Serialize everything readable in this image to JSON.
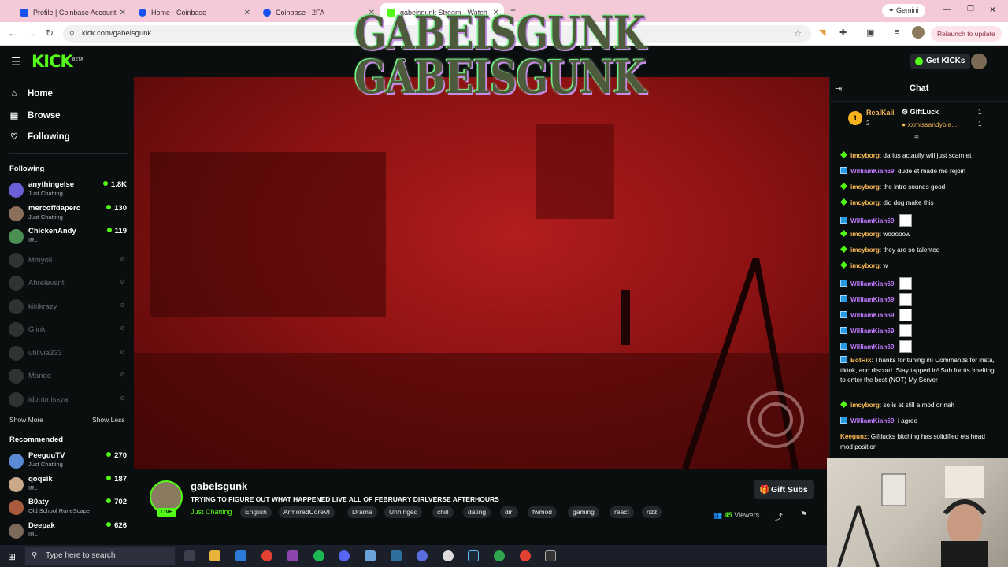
{
  "browser": {
    "tabs": [
      {
        "title": "Profile | Coinbase Account",
        "color": "#1652f0"
      },
      {
        "title": "Home - Coinbase",
        "color": "#1652f0"
      },
      {
        "title": "Coinbase - 2FA",
        "color": "#1652f0"
      },
      {
        "title": "gabeisgunk Stream - Watch",
        "color": "#53fc18"
      }
    ],
    "url": "kick.com/gabeisgunk",
    "relaunch": "Relaunch to update",
    "gemini": "Gemini"
  },
  "kick": {
    "logo": "KICK",
    "logo_sup": "BETA",
    "get_kicks": "Get KICKs",
    "nav": [
      {
        "label": "Home",
        "icon": "home-icon",
        "glyph": "⌂"
      },
      {
        "label": "Browse",
        "icon": "browse-icon",
        "glyph": "▤"
      },
      {
        "label": "Following",
        "icon": "heart-icon",
        "glyph": "♡"
      }
    ],
    "following_title": "Following",
    "following": [
      {
        "name": "anythingelse",
        "category": "Just Chatting",
        "viewers": "1.8K",
        "color": "#6b5fd6"
      },
      {
        "name": "mercoffdaperc",
        "category": "Just Chatting",
        "viewers": "130",
        "color": "#8a6f5a"
      },
      {
        "name": "ChickenAndy",
        "category": "IRL",
        "viewers": "119",
        "color": "#4c8f52"
      },
      {
        "name": "Mmyoil",
        "offline": true,
        "color": "#777"
      },
      {
        "name": "Ahrelevant",
        "offline": true,
        "color": "#777"
      },
      {
        "name": "kikikrazy",
        "offline": true,
        "color": "#777"
      },
      {
        "name": "Glink",
        "offline": true,
        "color": "#777"
      },
      {
        "name": "uhlivia333",
        "offline": true,
        "color": "#777"
      },
      {
        "name": "Mando",
        "offline": true,
        "color": "#777"
      },
      {
        "name": "idontmissya",
        "offline": true,
        "color": "#777"
      }
    ],
    "show_more": "Show More",
    "show_less": "Show Less",
    "recommended_title": "Recommended",
    "recommended": [
      {
        "name": "PeeguuTV",
        "category": "Just Chatting",
        "viewers": "270",
        "color": "#5b8bd6"
      },
      {
        "name": "qoqsik",
        "category": "IRL",
        "viewers": "187",
        "color": "#c9a98a"
      },
      {
        "name": "B0aty",
        "category": "Old School RuneScape",
        "viewers": "702",
        "color": "#a85b3c"
      },
      {
        "name": "Deepak",
        "category": "IRL",
        "viewers": "626",
        "color": "#7a6a5a"
      }
    ]
  },
  "stream": {
    "banner_line1": "GABEISGUNK",
    "banner_line2": "GABEISGUNK",
    "channel": "gabeisgunk",
    "live": "LIVE",
    "title": "TRYING TO FIGURE OUT WHAT HAPPENED  LIVE ALL OF FEBRUARY DIRLVERSE AFTERHOURS",
    "category": "Just Chatting",
    "tags": [
      "English",
      "ArmoredCoreVI",
      "Drama",
      "Unhinged",
      "chill",
      "dating",
      "dirl",
      "fwmod",
      "gaming",
      "react",
      "rizz"
    ],
    "viewers": "45",
    "viewers_label": "Viewers",
    "gift_subs": "Gift Subs"
  },
  "chat": {
    "title": "Chat",
    "leaderboard": [
      {
        "rank": "1",
        "name": "RealKali",
        "count": "2"
      },
      {
        "name": "GiftLuck",
        "count": "1"
      },
      {
        "name": "xxmissandybla...",
        "count": "1"
      }
    ],
    "messages": [
      {
        "user": "imcyborg",
        "badge": "green",
        "color": "#f7b955",
        "text": "darius actaully will just scam et"
      },
      {
        "user": "WilliamKian69",
        "badge": "sub",
        "color": "#c27cff",
        "text": "dude et made me rejoin"
      },
      {
        "user": "imcyborg",
        "badge": "green",
        "color": "#f7b955",
        "text": "the intro sounds good"
      },
      {
        "user": "imcyborg",
        "badge": "green",
        "color": "#f7b955",
        "text": "did dog make this"
      },
      {
        "user": "WilliamKian69",
        "badge": "sub",
        "color": "#c27cff",
        "text": "",
        "emote": true
      },
      {
        "user": "imcyborg",
        "badge": "green",
        "color": "#f7b955",
        "text": "wooooow"
      },
      {
        "user": "imcyborg",
        "badge": "green",
        "color": "#f7b955",
        "text": "they are so talented"
      },
      {
        "user": "imcyborg",
        "badge": "green",
        "color": "#f7b955",
        "text": "w"
      },
      {
        "user": "WilliamKian69",
        "badge": "sub",
        "color": "#c27cff",
        "text": "",
        "emote": true
      },
      {
        "user": "WilliamKian69",
        "badge": "sub",
        "color": "#c27cff",
        "text": "",
        "emote": true
      },
      {
        "user": "WilliamKian69",
        "badge": "sub",
        "color": "#c27cff",
        "text": "",
        "emote": true
      },
      {
        "user": "WilliamKian69",
        "badge": "sub",
        "color": "#c27cff",
        "text": "",
        "emote": true
      },
      {
        "user": "WilliamKian69",
        "badge": "sub",
        "color": "#c27cff",
        "text": "",
        "emote": true
      },
      {
        "user": "BotRix",
        "badge": "sub",
        "color": "#f7b955",
        "text": "Thanks for tuning in! Commands for insta, tiktok, and discord. Stay tapped in! Sub for tts !melting to enter the best (NOT) My Server"
      },
      {
        "user": "imcyborg",
        "badge": "green",
        "color": "#f7b955",
        "text": "so is et still a mod or nah"
      },
      {
        "user": "WilliamKian69",
        "badge": "sub",
        "color": "#c27cff",
        "text": "i agree"
      },
      {
        "user": "Keegunz",
        "badge": "",
        "color": "#f7b955",
        "text": "Giftlucks bitching has solidified ets head mod position"
      }
    ]
  },
  "taskbar": {
    "search_placeholder": "Type here to search"
  }
}
